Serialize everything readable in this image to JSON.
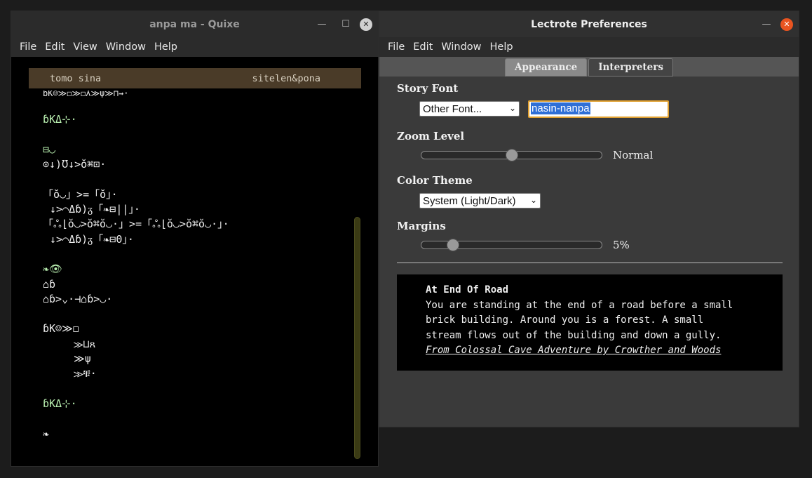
{
  "quixe": {
    "title": "anpa ma - Quixe",
    "menu": [
      "File",
      "Edit",
      "View",
      "Window",
      "Help"
    ],
    "status_left": "tomo sina",
    "status_right": "sitelen&pona",
    "lines": [
      {
        "text": "ɓK☺≫◻≫◻ʎ≫ψ≫⊓⇝·",
        "cls": "cut"
      },
      {
        "text": "",
        "cls": ""
      },
      {
        "text": "ɓKΔ⊹·",
        "cls": "green"
      },
      {
        "text": "",
        "cls": ""
      },
      {
        "text": "⊟◡",
        "cls": "green"
      },
      {
        "text": "⊙↓)Ʊ↓>ŏ⌘⊡·",
        "cls": ""
      },
      {
        "text": "",
        "cls": ""
      },
      {
        "text": "「ŏ◡」>=「ŏ」·",
        "cls": ""
      },
      {
        "text": "↓>⌒Δɓ)ᵹ「❧⊟||」·",
        "cls": "indent1"
      },
      {
        "text": "「ஃ⌊ŏ◡>ŏ⌘ŏ◡·」>=「ஃ⌊ŏ◡>ŏ⌘ŏ◡·」·",
        "cls": ""
      },
      {
        "text": "↓>⌒Δɓ)ᵹ「❧⊟0」·",
        "cls": "indent1"
      },
      {
        "text": "",
        "cls": ""
      },
      {
        "text": "❧👁",
        "cls": "green"
      },
      {
        "text": "⌂ɓ",
        "cls": ""
      },
      {
        "text": "⌂ɓ>⌄·⊣⌂ɓ>◡·",
        "cls": ""
      },
      {
        "text": "",
        "cls": ""
      },
      {
        "text": "ɓK☺≫◻",
        "cls": ""
      },
      {
        "text": "≫⊔ጸ",
        "cls": "indent"
      },
      {
        "text": "≫ψ",
        "cls": "indent"
      },
      {
        "text": "≫ቹ·",
        "cls": "indent"
      },
      {
        "text": "",
        "cls": ""
      },
      {
        "text": "ɓKΔ⊹·",
        "cls": "green"
      },
      {
        "text": "",
        "cls": ""
      },
      {
        "text": "❧",
        "cls": ""
      }
    ]
  },
  "prefs": {
    "title": "Lectrote Preferences",
    "menu": [
      "File",
      "Edit",
      "Window",
      "Help"
    ],
    "tabs": [
      "Appearance",
      "Interpreters"
    ],
    "story_font_label": "Story Font",
    "font_select": "Other Font...",
    "font_name": "nasin-nanpa",
    "zoom_label": "Zoom Level",
    "zoom_value": "Normal",
    "zoom_fraction": 0.5,
    "theme_label": "Color Theme",
    "theme_select": "System (Light/Dark)",
    "margins_label": "Margins",
    "margins_value": "5%",
    "margins_fraction": 0.15,
    "preview": {
      "title": "At End Of Road",
      "lines": [
        "You are standing at the end of a road before a small",
        "brick building. Around you is a forest. A small",
        "stream flows out of the building and down a gully."
      ],
      "source": "From Colossal Cave Adventure by Crowther and Woods"
    }
  },
  "icons": {
    "minimize": "minimize-icon",
    "maximize": "maximize-icon",
    "close": "close-icon"
  }
}
